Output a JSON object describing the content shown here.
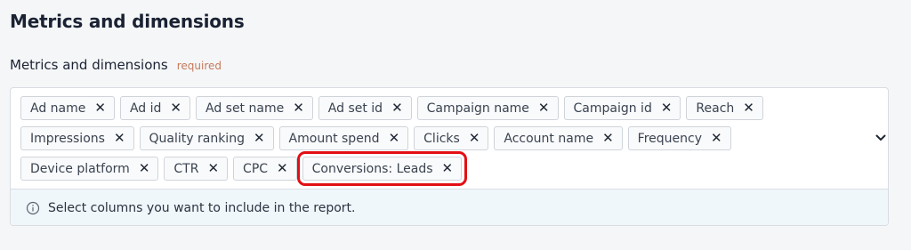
{
  "section": {
    "title": "Metrics and dimensions"
  },
  "field": {
    "label": "Metrics and dimensions",
    "required_label": "required",
    "hint": "Select columns you want to include in the report.",
    "rows": [
      [
        "Ad name",
        "Ad id",
        "Ad set name",
        "Ad set id",
        "Campaign name",
        "Campaign id",
        "Reach"
      ],
      [
        "Impressions",
        "Quality ranking",
        "Amount spend",
        "Clicks",
        "Account name",
        "Frequency"
      ],
      [
        "Device platform",
        "CTR",
        "CPC",
        "Conversions: Leads"
      ]
    ],
    "highlighted_chip": "Conversions: Leads",
    "remove_glyph": "✕",
    "dropdown_icon": "chevron-down-icon",
    "info_icon": "info-icon"
  },
  "colors": {
    "highlight": "#e20f14",
    "required": "#c47a5c",
    "hint_background": "#f0f7fb"
  }
}
